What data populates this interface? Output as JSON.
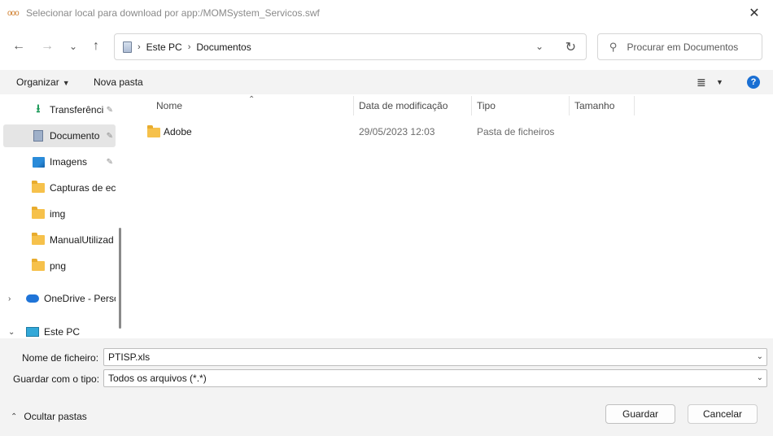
{
  "window": {
    "title": "Selecionar local para download por app:/MOMSystem_Servicos.swf",
    "close_glyph": "✕"
  },
  "nav": {
    "back_glyph": "←",
    "forward_glyph": "→",
    "recent_glyph": "⌄",
    "up_glyph": "↑"
  },
  "address": {
    "crumbs": [
      "Este PC",
      "Documentos"
    ],
    "separator": "›",
    "dropdown_glyph": "⌄",
    "refresh_glyph": "↻"
  },
  "search": {
    "placeholder": "Procurar em Documentos"
  },
  "toolbar": {
    "organize_label": "Organizar",
    "new_folder_label": "Nova pasta",
    "caret_glyph": "▼",
    "view_glyph": "≣",
    "help_glyph": "?"
  },
  "sidebar": {
    "pin_glyph": "📌",
    "items": [
      {
        "label": "Transferênci",
        "icon": "download-icon",
        "pinned": true
      },
      {
        "label": "Documento",
        "icon": "documents-icon",
        "pinned": true,
        "selected": true
      },
      {
        "label": "Imagens",
        "icon": "pictures-icon",
        "pinned": true
      },
      {
        "label": "Capturas de ecr",
        "icon": "folder-icon"
      },
      {
        "label": "img",
        "icon": "folder-icon"
      },
      {
        "label": "ManualUtilizad",
        "icon": "folder-icon"
      },
      {
        "label": "png",
        "icon": "folder-icon"
      },
      {
        "label": "OneDrive - Perso",
        "icon": "cloud-icon",
        "expander": "›"
      },
      {
        "label": "Este PC",
        "icon": "computer-icon",
        "expander": "⌄"
      }
    ]
  },
  "filelist": {
    "columns": [
      "Nome",
      "Data de modificação",
      "Tipo",
      "Tamanho"
    ],
    "sort_glyph": "⌃",
    "rows": [
      {
        "name": "Adobe",
        "modified": "29/05/2023 12:03",
        "type": "Pasta de ficheiros",
        "size": ""
      }
    ]
  },
  "form": {
    "filename_label": "Nome de ficheiro:",
    "filename_value": "PTISP.xls",
    "filetype_label": "Guardar com o tipo:",
    "filetype_value": "Todos os arquivos (*.*)",
    "caret_glyph": "⌄",
    "hide_folders_label": "Ocultar pastas",
    "hide_caret_glyph": "⌃",
    "save_label": "Guardar",
    "cancel_label": "Cancelar"
  }
}
